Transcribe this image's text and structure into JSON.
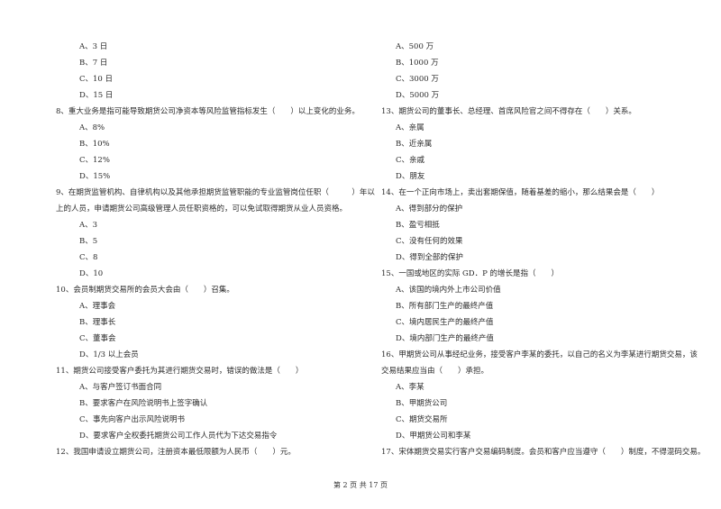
{
  "left_column": [
    {
      "kind": "opt",
      "text": "A、3 日"
    },
    {
      "kind": "opt",
      "text": "B、7 日"
    },
    {
      "kind": "opt",
      "text": "C、10 日"
    },
    {
      "kind": "opt",
      "text": "D、15 日"
    },
    {
      "kind": "q",
      "text": "8、重大业务是指可能导致期货公司净资本等风险监管指标发生（　　）以上变化的业务。"
    },
    {
      "kind": "opt",
      "text": "A、8%"
    },
    {
      "kind": "opt",
      "text": "B、10%"
    },
    {
      "kind": "opt",
      "text": "C、12%"
    },
    {
      "kind": "opt",
      "text": "D、15%"
    },
    {
      "kind": "q",
      "text": "9、在期货监管机构、自律机构以及其他承担期货监管职能的专业监管岗位任职（　　　）年以"
    },
    {
      "kind": "cont",
      "text": "上的人员，申请期货公司高级管理人员任职资格的，可以免试取得期货从业人员资格。"
    },
    {
      "kind": "opt",
      "text": "A、3"
    },
    {
      "kind": "opt",
      "text": "B、5"
    },
    {
      "kind": "opt",
      "text": "C、8"
    },
    {
      "kind": "opt",
      "text": "D、10"
    },
    {
      "kind": "q",
      "text": "10、会员制期货交易所的会员大会由（　　）召集。"
    },
    {
      "kind": "opt",
      "text": "A、理事会"
    },
    {
      "kind": "opt",
      "text": "B、理事长"
    },
    {
      "kind": "opt",
      "text": "C、董事会"
    },
    {
      "kind": "opt",
      "text": "D、1/3 以上会员"
    },
    {
      "kind": "q",
      "text": "11、期货公司接受客户委托为其进行期货交易时，错误的做法是（　　）"
    },
    {
      "kind": "opt",
      "text": "A、与客户签订书面合同"
    },
    {
      "kind": "opt",
      "text": "B、要求客户在风险说明书上签字确认"
    },
    {
      "kind": "opt",
      "text": "C、事先向客户出示风险说明书"
    },
    {
      "kind": "opt",
      "text": "D、要求客户全权委托期货公司工作人员代为下达交易指令"
    },
    {
      "kind": "q",
      "text": "12、我国申请设立期货公司，注册资本最低限额为人民币（　　）元。"
    }
  ],
  "right_column": [
    {
      "kind": "opt",
      "text": "A、500 万"
    },
    {
      "kind": "opt",
      "text": "B、1000 万"
    },
    {
      "kind": "opt",
      "text": "C、3000 万"
    },
    {
      "kind": "opt",
      "text": "D、5000 万"
    },
    {
      "kind": "q",
      "text": "13、期货公司的董事长、总经理、首席风险官之间不得存在（　　）关系。"
    },
    {
      "kind": "opt",
      "text": "A、亲属"
    },
    {
      "kind": "opt",
      "text": "B、近亲属"
    },
    {
      "kind": "opt",
      "text": "C、亲戚"
    },
    {
      "kind": "opt",
      "text": "D、朋友"
    },
    {
      "kind": "q",
      "text": "14、在一个正向市场上，卖出套期保值，随着基差的缩小，那么结果会是（　　）"
    },
    {
      "kind": "opt",
      "text": "A、得到部分的保护"
    },
    {
      "kind": "opt",
      "text": "B、盈亏相抵"
    },
    {
      "kind": "opt",
      "text": "C、没有任何的效果"
    },
    {
      "kind": "opt",
      "text": "D、得到全部的保护"
    },
    {
      "kind": "q",
      "text": "15、一国或地区的实际 GD．P 的增长是指（　　）"
    },
    {
      "kind": "opt",
      "text": "A、该国的境内外上市公司价值"
    },
    {
      "kind": "opt",
      "text": "B、所有部门生产的最终产值"
    },
    {
      "kind": "opt",
      "text": "C、境内居民生产的最终产值"
    },
    {
      "kind": "opt",
      "text": "D、境内部门生产的最终产值"
    },
    {
      "kind": "q",
      "text": "16、甲期货公司从事经纪业务，接受客户李某的委托，以自己的名义为李某进行期货交易，该"
    },
    {
      "kind": "cont",
      "text": "交易结果应当由（　　）承担。"
    },
    {
      "kind": "opt",
      "text": "A、李某"
    },
    {
      "kind": "opt",
      "text": "B、甲期货公司"
    },
    {
      "kind": "opt",
      "text": "C、期货交易所"
    },
    {
      "kind": "opt",
      "text": "D、甲期货公司和李某"
    },
    {
      "kind": "q",
      "text": "17、宋体期货交易实行客户交易编码制度。会员和客户应当遵守（　　）制度，不得混码交易。"
    }
  ],
  "footer": {
    "page_label": "第 2 页 共 17 页"
  }
}
